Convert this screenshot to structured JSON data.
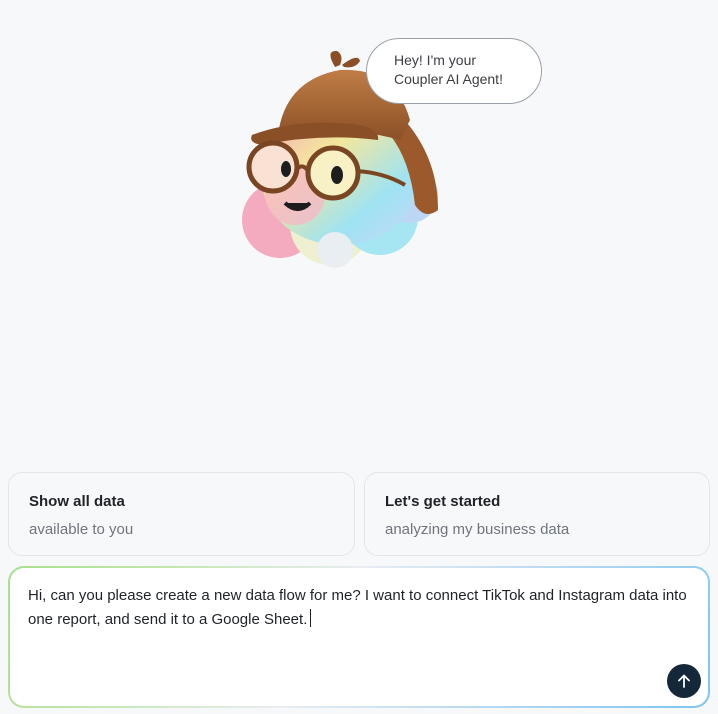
{
  "mascot": {
    "bubble_line1": "Hey! I'm your",
    "bubble_line2": "Coupler AI Agent!"
  },
  "suggestions": [
    {
      "title": "Show all data",
      "subtitle": "available to you"
    },
    {
      "title": "Let's get started",
      "subtitle": "analyzing my business data"
    }
  ],
  "composer": {
    "value": "Hi, can you please create a new data flow for me? I want to connect TikTok and Instagram data into one report, and send it to a Google Sheet."
  },
  "icons": {
    "send": "arrow-up-icon",
    "mascot": "detective-cloud-mascot-icon"
  },
  "colors": {
    "send_button": "#15283a",
    "hat": "#a8683a",
    "background": "#f7f8fa"
  }
}
